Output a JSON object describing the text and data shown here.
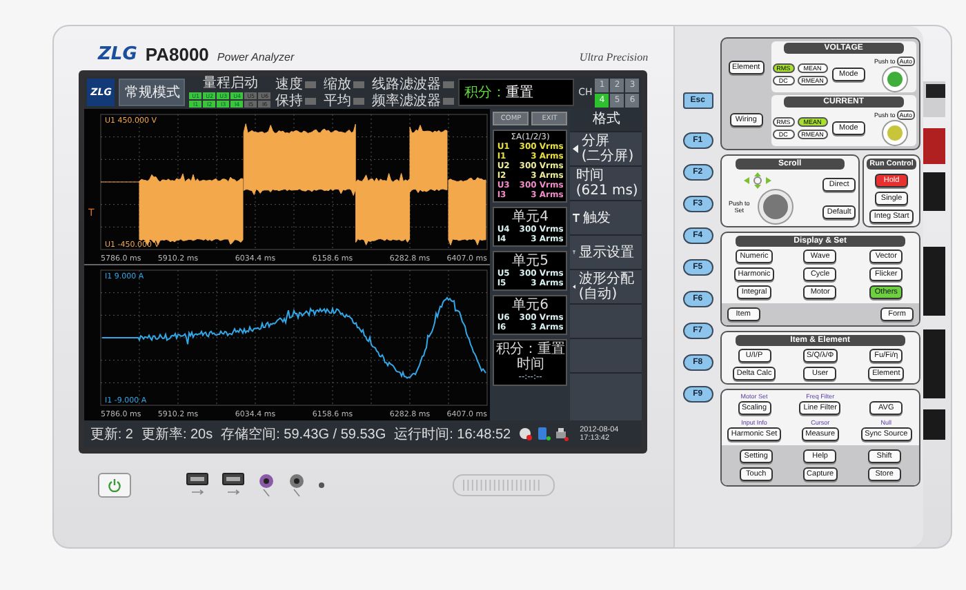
{
  "header": {
    "brand": "ZLG",
    "model": "PA8000",
    "subtitle": "Power Analyzer",
    "tagline": "Ultra Precision"
  },
  "screen": {
    "logo": "ZLG",
    "mode": "常规模式",
    "range": {
      "label": "量程启动",
      "voltage": [
        {
          "label": "U1",
          "on": true
        },
        {
          "label": "U2",
          "on": true
        },
        {
          "label": "U3",
          "on": true
        },
        {
          "label": "U4",
          "on": true
        },
        {
          "label": "U5",
          "on": false
        },
        {
          "label": "U6",
          "on": false
        }
      ],
      "current": [
        {
          "label": "I1",
          "on": true
        },
        {
          "label": "I2",
          "on": true
        },
        {
          "label": "I3",
          "on": true
        },
        {
          "label": "I4",
          "on": true
        },
        {
          "label": "I5",
          "on": false
        },
        {
          "label": "I6",
          "on": false
        }
      ]
    },
    "indicators": [
      {
        "label": "速度"
      },
      {
        "label": "保持"
      },
      {
        "label": "缩放"
      },
      {
        "label": "平均"
      },
      {
        "label": "线路滤波器"
      },
      {
        "label": "频率滤波器"
      }
    ],
    "integration": {
      "label": "积分：",
      "value": "重置"
    },
    "ch": {
      "label": "CH",
      "keys": [
        {
          "label": "1",
          "selected": false
        },
        {
          "label": "2",
          "selected": false
        },
        {
          "label": "3",
          "selected": false
        },
        {
          "label": "4",
          "selected": true
        },
        {
          "label": "5",
          "selected": false
        },
        {
          "label": "6",
          "selected": false
        }
      ]
    },
    "trigger_mark": "T",
    "plots": [
      {
        "kind": "voltage",
        "top": "U1  450.000 V",
        "bottom": "U1  -450.000 V",
        "ticks": [
          "5786.0 ms",
          "5910.2 ms",
          "6034.4 ms",
          "6158.6 ms",
          "6282.8 ms",
          "6407.0 ms"
        ]
      },
      {
        "kind": "current",
        "top": "I1  9.000 A",
        "bottom": "I1  -9.000 A",
        "ticks": [
          "5786.0 ms",
          "5910.2 ms",
          "6034.4 ms",
          "6158.6 ms",
          "6282.8 ms",
          "6407.0 ms"
        ]
      }
    ],
    "units": {
      "buttons": [
        "COMP",
        "EXIT"
      ],
      "groups": [
        {
          "title": "ΣA(1/2/3)",
          "rows": [
            {
              "name": "U1",
              "value": "300 Vrms",
              "color": "#e8e040"
            },
            {
              "name": "I1",
              "value": "3 Arms",
              "color": "#e8e040"
            },
            {
              "name": "U2",
              "value": "300 Vrms",
              "color": "#ecec9a"
            },
            {
              "name": "I2",
              "value": "3 Arms",
              "color": "#ecec9a"
            },
            {
              "name": "U3",
              "value": "300 Vrms",
              "color": "#f08cc8"
            },
            {
              "name": "I3",
              "value": "3 Arms",
              "color": "#f08cc8"
            }
          ]
        },
        {
          "title": "单元4",
          "rows": [
            {
              "name": "U4",
              "value": "300 Vrms",
              "color": "#d8f0f0"
            },
            {
              "name": "I4",
              "value": "3 Arms",
              "color": "#d8f0f0"
            }
          ]
        },
        {
          "title": "单元5",
          "rows": [
            {
              "name": "U5",
              "value": "300 Vrms",
              "color": "#d8f0f0"
            },
            {
              "name": "I5",
              "value": "3 Arms",
              "color": "#d8f0f0"
            }
          ]
        },
        {
          "title": "单元6",
          "rows": [
            {
              "name": "U6",
              "value": "300 Vrms",
              "color": "#d8f0f0"
            },
            {
              "name": "I6",
              "value": "3 Arms",
              "color": "#d8f0f0"
            }
          ]
        }
      ],
      "integration_box": {
        "title": "积分：重置",
        "label": "时间",
        "value": "--:--:--"
      }
    },
    "menu": {
      "title": "格式",
      "items": [
        {
          "kind": "select",
          "label": "分屏",
          "value": "(二分屏)"
        },
        {
          "kind": "select",
          "label": "时间",
          "value": "(621 ms)"
        },
        {
          "kind": "page",
          "label": "触发"
        },
        {
          "kind": "page",
          "label": "显示设置"
        },
        {
          "kind": "select",
          "label": "波形分配",
          "value": "(自动)"
        }
      ]
    },
    "status": {
      "update": "更新: 2",
      "rate": "更新率: 20s",
      "storage": "存储空间: 59.43G / 59.53G",
      "runtime": "运行时间: 16:48:52",
      "date": "2012-08-04",
      "time": "17:13:42"
    }
  },
  "softkeys": [
    "Esc",
    "F1",
    "F2",
    "F3",
    "F4",
    "F5",
    "F6",
    "F7",
    "F8",
    "F9"
  ],
  "panel": {
    "setup": [
      "Element",
      "Wiring"
    ],
    "ranges": [
      {
        "title": "VOLTAGE",
        "color": "#3fae3a",
        "modes": [
          {
            "label": "RMS",
            "lit": true
          },
          {
            "label": "MEAN",
            "lit": false
          },
          {
            "label": "DC",
            "lit": false
          },
          {
            "label": "RMEAN",
            "lit": false
          }
        ],
        "mode_button": "Mode",
        "push": "Push to",
        "auto": "Auto"
      },
      {
        "title": "CURRENT",
        "color": "#c8c43c",
        "modes": [
          {
            "label": "RMS",
            "lit": false
          },
          {
            "label": "MEAN",
            "lit": true
          },
          {
            "label": "DC",
            "lit": false
          },
          {
            "label": "RMEAN",
            "lit": false
          }
        ],
        "mode_button": "Mode",
        "push": "Push to",
        "auto": "Auto"
      }
    ],
    "scroll": {
      "title": "Scroll",
      "push": "Push to Set",
      "buttons": [
        "Direct",
        "Default"
      ]
    },
    "run": {
      "title": "Run Control",
      "buttons": [
        {
          "label": "Hold",
          "lit": true
        },
        {
          "label": "Single",
          "lit": false
        },
        {
          "label": "Integ Start",
          "lit": false
        }
      ]
    },
    "display": {
      "title": "Display & Set",
      "buttons": [
        {
          "label": "Numeric",
          "lit": false
        },
        {
          "label": "Wave",
          "lit": false
        },
        {
          "label": "Vector",
          "lit": false
        },
        {
          "label": "Harmonic",
          "lit": false
        },
        {
          "label": "Cycle",
          "lit": false
        },
        {
          "label": "Flicker",
          "lit": false
        },
        {
          "label": "Integral",
          "lit": false
        },
        {
          "label": "Motor",
          "lit": false
        },
        {
          "label": "Others",
          "lit": true
        }
      ],
      "sub": [
        "Item",
        "Form"
      ]
    },
    "item": {
      "title": "Item & Element",
      "buttons": [
        "U/I/P",
        "S/Q/λ/Φ",
        "Fu/Fi/η",
        "Delta Calc",
        "User",
        "Element"
      ]
    },
    "misc": [
      {
        "caption": "Motor Set",
        "label": "Scaling"
      },
      {
        "caption": "Freq Filter",
        "label": "Line Filter"
      },
      {
        "label": "AVG"
      },
      {
        "caption": "Input Info",
        "label": "Harmonic Set"
      },
      {
        "caption": "Cursor",
        "label": "Measure"
      },
      {
        "caption": "Null",
        "label": "Sync Source"
      }
    ],
    "system": [
      "Setting",
      "Help",
      "Shift",
      "Touch",
      "Capture",
      "Store"
    ]
  }
}
